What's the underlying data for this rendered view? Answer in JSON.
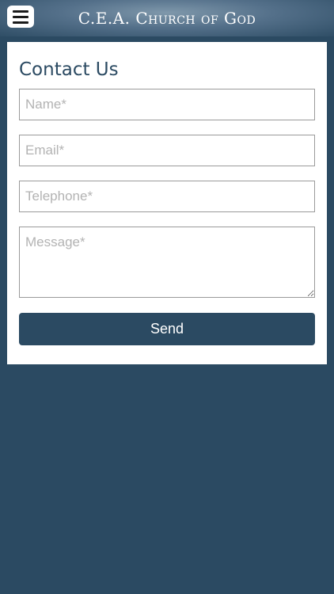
{
  "header": {
    "title": "C.E.A. Church of God",
    "menu_icon": "hamburger-menu-icon"
  },
  "contact_form": {
    "title": "Contact Us",
    "name_placeholder": "Name*",
    "email_placeholder": "Email*",
    "telephone_placeholder": "Telephone*",
    "message_placeholder": "Message*",
    "send_label": "Send"
  },
  "colors": {
    "primary": "#2b4a62",
    "card_background": "#ffffff",
    "placeholder": "#b3b3b3",
    "field_border": "#9a9a9a"
  }
}
